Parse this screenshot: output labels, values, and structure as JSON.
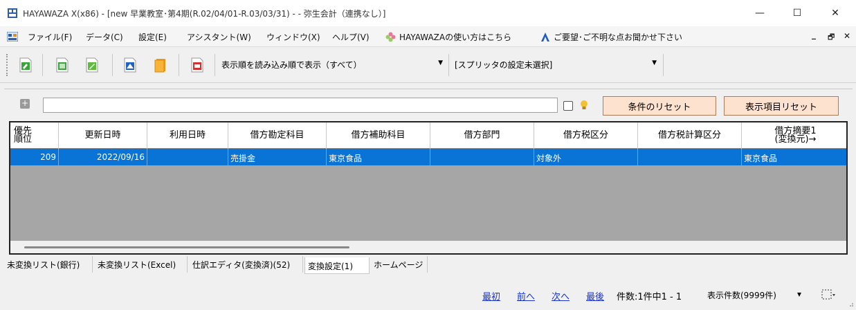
{
  "window": {
    "title": "HAYAWAZA X(x86) - [new 早業教室･第4期(R.02/04/01-R.03/03/31) - - 弥生会計（連携なし）]",
    "minimize": "—",
    "maximize": "☐",
    "close": "✕"
  },
  "menu": {
    "items": [
      "ファイル(F)",
      "データ(C)",
      "設定(E)",
      "アシスタント(W)",
      "ウィンドウ(X)",
      "ヘルプ(V)"
    ],
    "howto": "HAYAWAZAの使い方はこちら",
    "feedback": "ご要望･ご不明な点お聞かせ下さい",
    "mdi_min": "_",
    "mdi_restore": "🗗",
    "mdi_close": "✕"
  },
  "toolbar": {
    "sort_combo": "表示順を読み込み順で表示（すべて）",
    "splitter_combo": "[スプリッタの設定未選択]"
  },
  "filter": {
    "plus": "+",
    "reset_conditions": "条件のリセット",
    "reset_columns": "表示項目リセット"
  },
  "grid": {
    "headers": [
      "優先\n順位",
      "更新日時",
      "利用日時",
      "借方勘定科目",
      "借方補助科目",
      "借方部門",
      "借方税区分",
      "借方税計算区分",
      "借方摘要1\n(変換元)→"
    ],
    "rows": [
      [
        "209",
        "2022/09/16",
        "",
        "売掛金",
        "東京食品",
        "",
        "対象外",
        "",
        "東京食品"
      ]
    ]
  },
  "tabs": [
    "未変換リスト(銀行)",
    "未変換リスト(Excel)",
    "仕訳エディタ(変換済)(52)",
    "変換設定(1)",
    "ホームページ"
  ],
  "status": {
    "first": "最初",
    "prev": "前へ",
    "next": "次へ",
    "last": "最後",
    "count": "件数:1件中1 - 1",
    "display_count": "表示件数(9999件)",
    "dropdown": "▾"
  },
  "colors": {
    "selected_row": "#0a74d6",
    "reset_button": "#fde3cf",
    "link": "#1a33cc"
  }
}
